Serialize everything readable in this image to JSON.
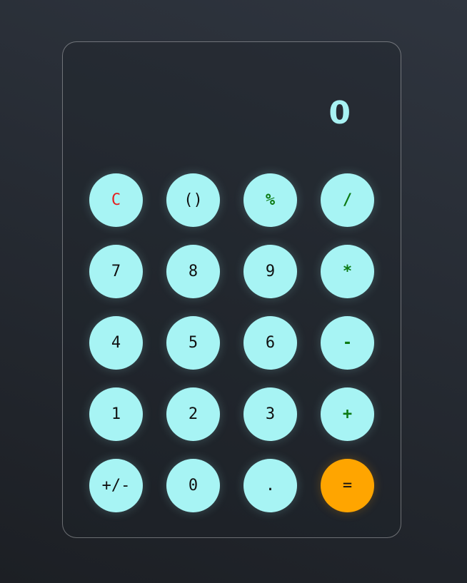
{
  "display": {
    "value": "0"
  },
  "keys": [
    {
      "id": "clear",
      "label": "C",
      "kind": "clear"
    },
    {
      "id": "parentheses",
      "label": "()",
      "kind": "digit"
    },
    {
      "id": "percent",
      "label": "%",
      "kind": "op"
    },
    {
      "id": "divide",
      "label": "/",
      "kind": "op"
    },
    {
      "id": "7",
      "label": "7",
      "kind": "digit"
    },
    {
      "id": "8",
      "label": "8",
      "kind": "digit"
    },
    {
      "id": "9",
      "label": "9",
      "kind": "digit"
    },
    {
      "id": "multiply",
      "label": "*",
      "kind": "op"
    },
    {
      "id": "4",
      "label": "4",
      "kind": "digit"
    },
    {
      "id": "5",
      "label": "5",
      "kind": "digit"
    },
    {
      "id": "6",
      "label": "6",
      "kind": "digit"
    },
    {
      "id": "subtract",
      "label": "-",
      "kind": "op"
    },
    {
      "id": "1",
      "label": "1",
      "kind": "digit"
    },
    {
      "id": "2",
      "label": "2",
      "kind": "digit"
    },
    {
      "id": "3",
      "label": "3",
      "kind": "digit"
    },
    {
      "id": "add",
      "label": "+",
      "kind": "op"
    },
    {
      "id": "plus-minus",
      "label": "+/-",
      "kind": "digit"
    },
    {
      "id": "0",
      "label": "0",
      "kind": "digit"
    },
    {
      "id": "decimal",
      "label": ".",
      "kind": "digit"
    },
    {
      "id": "equals",
      "label": "=",
      "kind": "equals"
    }
  ],
  "colors": {
    "key_bg": "#a7f4f4",
    "display_text": "#a8f2f3",
    "operator_text": "#0c7a13",
    "clear_text": "#e51f1f",
    "equals_bg": "#ffa500"
  }
}
